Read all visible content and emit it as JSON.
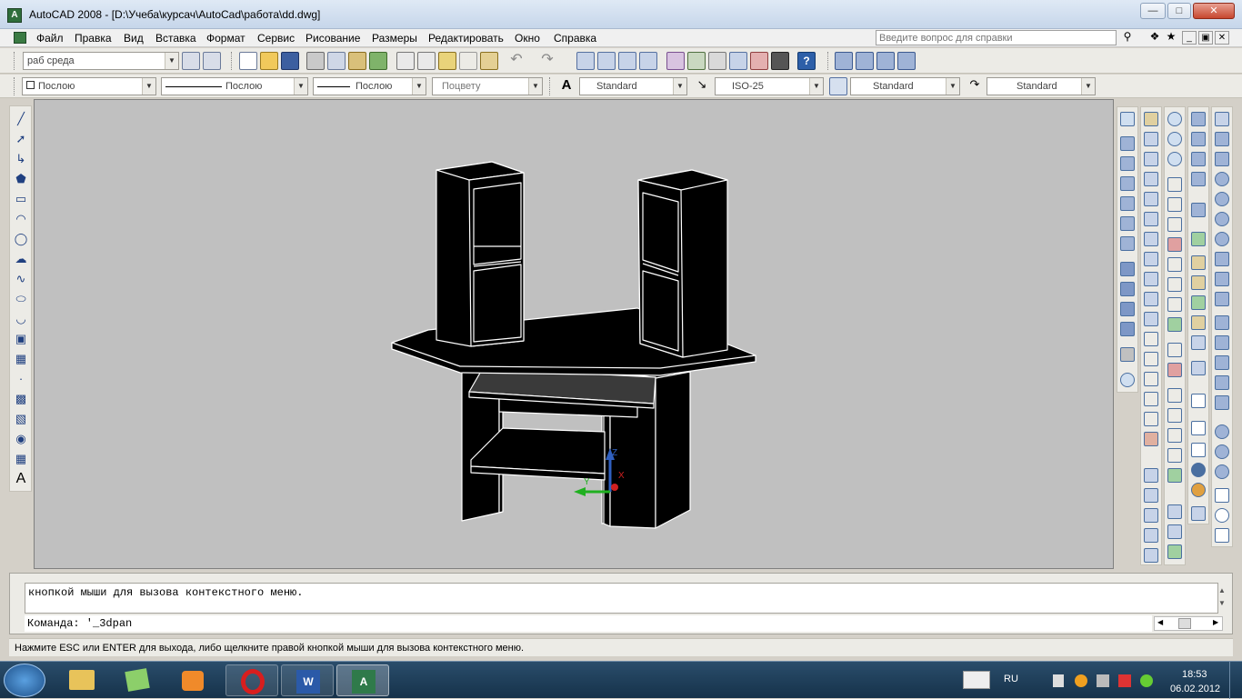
{
  "window": {
    "title": "AutoCAD 2008 - [D:\\Учеба\\курсач\\AutoCad\\работа\\dd.dwg]",
    "app_icon": "autocad-logo-icon"
  },
  "menu": {
    "items": [
      "Файл",
      "Правка",
      "Вид",
      "Вставка",
      "Формат",
      "Сервис",
      "Рисование",
      "Размеры",
      "Редактировать",
      "Окно",
      "Справка"
    ],
    "help_placeholder": "Введите вопрос для справки"
  },
  "toolbar1": {
    "workspace": "раб среда"
  },
  "toolbar2": {
    "color": "Послою",
    "linetype": "Послою",
    "lineweight": "Послою",
    "plotstyle": "Поцвету",
    "textstyle": "Standard",
    "dimstyle": "ISO-25",
    "tablestyle": "Standard",
    "mleaderstyle": "Standard"
  },
  "ucs": {
    "z_label": "Z",
    "y_label": "Y",
    "x_label": "X"
  },
  "command": {
    "history": "кнопкой мыши для вызова контекстного меню.",
    "prompt": "Команда: '_3dpan"
  },
  "status": {
    "text": "Нажмите ESC или ENTER для выхода, либо щелкните правой кнопкой мыши для вызова контекстного меню."
  },
  "taskbar": {
    "lang": "RU",
    "time": "18:53",
    "date": "06.02.2012"
  },
  "colors": {
    "viewport_bg": "#c0c0c0",
    "model": "#000000",
    "edges": "#ffffff"
  }
}
